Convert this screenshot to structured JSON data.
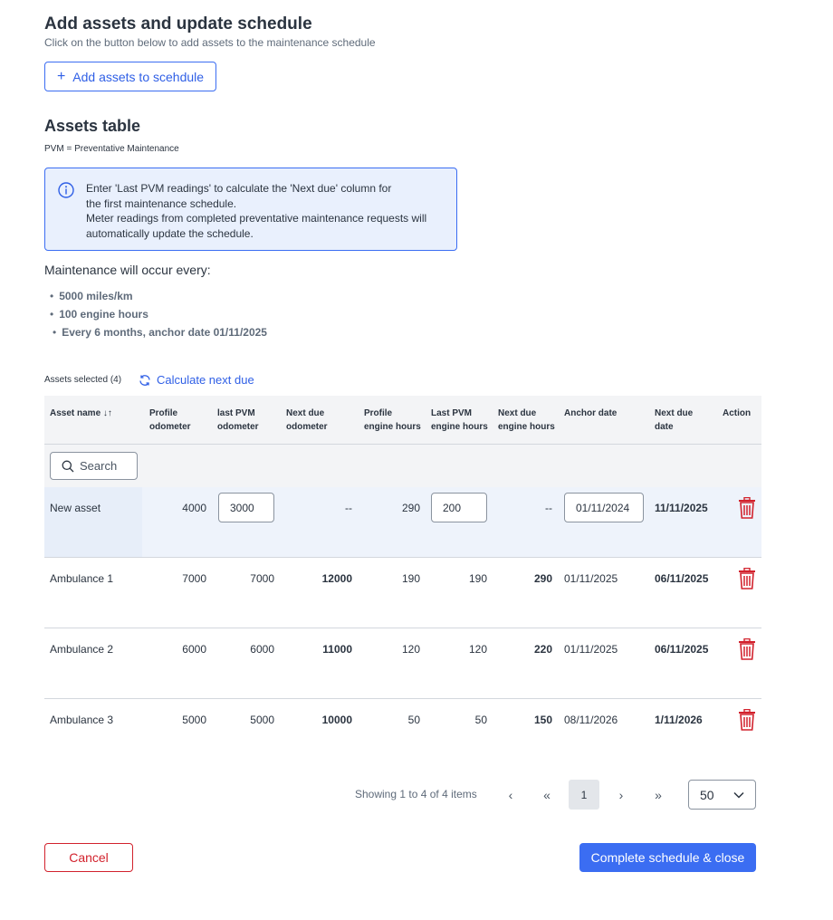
{
  "header": {
    "title": "Add assets and update schedule",
    "subtitle": "Click on the button below to add assets to the maintenance schedule",
    "add_button": "Add assets to scehdule"
  },
  "assets_section": {
    "title": "Assets table",
    "pvm_note": "PVM = Preventative Maintenance",
    "info_lines": [
      "Enter 'Last PVM readings' to calculate the 'Next due' column for",
      "the first maintenance schedule.",
      "Meter readings from completed preventative maintenance requests will",
      "automatically update the schedule."
    ],
    "occur_label": "Maintenance will occur every:",
    "occur_items": [
      "5000 miles/km",
      "100 engine hours",
      "Every 6 months, anchor date 01/11/2025"
    ],
    "selected_label": "Assets selected (4)",
    "calculate_label": "Calculate next due"
  },
  "table": {
    "headers": {
      "asset_name": "Asset name ↓↑",
      "profile_odometer": [
        "Profile",
        "odometer"
      ],
      "last_pvm_odometer": [
        "last PVM",
        "odometer"
      ],
      "next_due_odometer": [
        "Next due",
        "odometer"
      ],
      "profile_engine_hours": [
        "Profile",
        "engine hours"
      ],
      "last_pvm_engine_hours": [
        "Last PVM",
        "engine hours"
      ],
      "next_due_engine_hours": [
        "Next due",
        "engine hours"
      ],
      "anchor_date": "Anchor date",
      "next_due_date": [
        "Next due",
        "date"
      ],
      "action": "Action"
    },
    "search_placeholder": "Search",
    "rows": [
      {
        "name": "New asset",
        "profile_odo": "4000",
        "last_odo": "3000",
        "next_odo": "--",
        "profile_hours": "290",
        "last_hours": "200",
        "next_hours": "--",
        "anchor": "01/11/2024",
        "next_date": "11/11/2025"
      },
      {
        "name": "Ambulance 1",
        "profile_odo": "7000",
        "last_odo": "7000",
        "next_odo": "12000",
        "profile_hours": "190",
        "last_hours": "190",
        "next_hours": "290",
        "anchor": "01/11/2025",
        "next_date": "06/11/2025"
      },
      {
        "name": "Ambulance 2",
        "profile_odo": "6000",
        "last_odo": "6000",
        "next_odo": "11000",
        "profile_hours": "120",
        "last_hours": "120",
        "next_hours": "220",
        "anchor": "01/11/2025",
        "next_date": "06/11/2025"
      },
      {
        "name": "Ambulance 3",
        "profile_odo": "5000",
        "last_odo": "5000",
        "next_odo": "10000",
        "profile_hours": "50",
        "last_hours": "50",
        "next_hours": "150",
        "anchor": "08/11/2026",
        "next_date": "1/11/2026"
      }
    ]
  },
  "pagination": {
    "showing": "Showing 1 to 4 of 4 items",
    "prev": "‹",
    "first": "«",
    "current_page": "1",
    "next": "›",
    "last": "»",
    "per_page": "50"
  },
  "footer": {
    "cancel": "Cancel",
    "complete": "Complete schedule & close"
  },
  "colors": {
    "primary": "#3b6df2",
    "danger": "#d2222d",
    "info_bg": "#e9f0fd",
    "header_bg": "#f3f4f6"
  }
}
